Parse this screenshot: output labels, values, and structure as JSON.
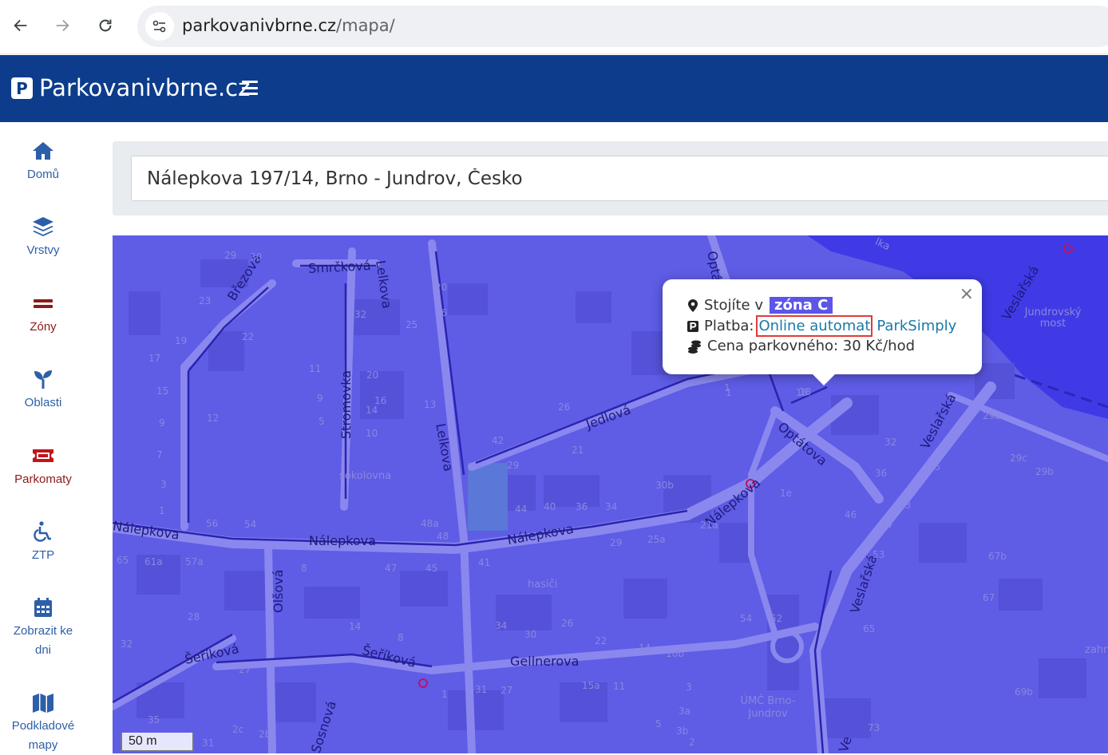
{
  "browser": {
    "url_host": "parkovanivbrne.cz",
    "url_path": "/mapa/"
  },
  "header": {
    "logo_letter": "P",
    "brand": "Parkovanivbrne.cz"
  },
  "sidebar": {
    "items": [
      {
        "label": "Domů",
        "icon": "home-icon"
      },
      {
        "label": "Vrstvy",
        "icon": "layers-icon"
      },
      {
        "label": "Zóny",
        "icon": "zones-icon"
      },
      {
        "label": "Oblasti",
        "icon": "seedling-icon"
      },
      {
        "label": "Parkomaty",
        "icon": "ticket-icon"
      },
      {
        "label": "ZTP",
        "icon": "wheelchair-icon"
      },
      {
        "label": "Zobrazit ke dni",
        "icon": "calendar-icon"
      },
      {
        "label": "Podkladové mapy",
        "icon": "map-icon"
      }
    ]
  },
  "search": {
    "value": "Nálepkova 197/14, Brno - Jundrov, Česko"
  },
  "popup": {
    "line1_text": "Stojíte v",
    "zone": "zóna C",
    "line2_label": "Platba:",
    "pay_link_1": "Online automat",
    "pay_link_2": "ParkSimply",
    "line3_text": "Cena parkovného: 30 Kč/hod",
    "close": "×"
  },
  "map": {
    "scale_label": "50 m",
    "streets": [
      "Smrčková",
      "Lelkova",
      "Optátova",
      "Březová",
      "Jedlová",
      "Stromovka",
      "Lelkova",
      "Nálepkova",
      "Nálepkova",
      "Nálepkova",
      "Nálepkova",
      "Optátova",
      "Veslařská",
      "Veslařská",
      "Veslařská",
      "Olšová",
      "Šeříková",
      "Šeříková",
      "Gellnerova",
      "Sosnová",
      "Ve"
    ],
    "pois": [
      "sokolovna",
      "hasiči",
      "Jundrovský most",
      "ÚMČ Brno-Jundrov",
      "zahr",
      "lka"
    ],
    "house_numbers": [
      "29",
      "23",
      "19",
      "17",
      "15",
      "9",
      "7",
      "3",
      "1",
      "32",
      "22",
      "25",
      "11",
      "9",
      "5",
      "20",
      "16",
      "14",
      "10",
      "13",
      "30",
      "20",
      "16",
      "12",
      "18",
      "26",
      "21",
      "42",
      "29",
      "44",
      "40",
      "36",
      "34",
      "30b",
      "1",
      "1e",
      "21a",
      "25a",
      "29",
      "48a",
      "48",
      "41",
      "56",
      "54",
      "65",
      "61a",
      "57a",
      "8",
      "47",
      "45",
      "28",
      "14",
      "34",
      "26",
      "30",
      "22",
      "14",
      "10b",
      "54",
      "52",
      "8",
      "32",
      "27",
      "35",
      "2c",
      "2b",
      "31",
      "1",
      "31",
      "27",
      "15a",
      "11",
      "3",
      "3a",
      "3b",
      "5",
      "2",
      "29a",
      "29c",
      "29b",
      "36",
      "35",
      "32",
      "46",
      "43",
      "47",
      "53",
      "67b",
      "67",
      "65",
      "69b",
      "73",
      "1",
      "18"
    ]
  }
}
